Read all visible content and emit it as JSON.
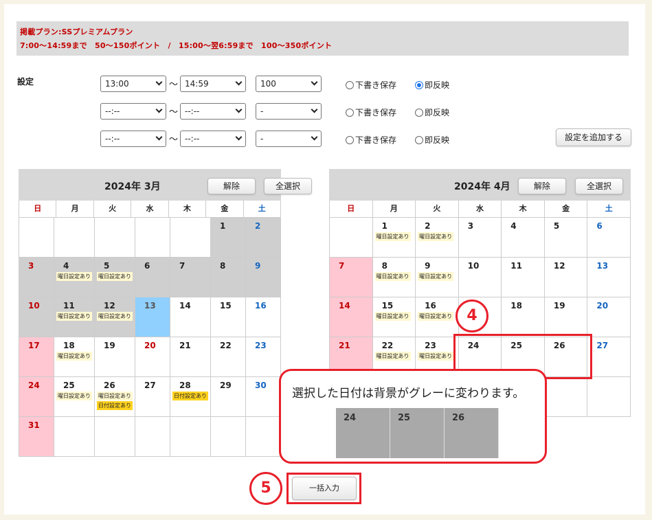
{
  "plan": {
    "line1": "掲載プラン:SSプレミアムプラン",
    "line2": "7:00〜14:59まで　50〜150ポイント　/　15:00〜翌6:59まで　100〜350ポイント"
  },
  "settings": {
    "label": "設定",
    "tilde": "〜",
    "rows": [
      {
        "start": "13:00",
        "end": "14:59",
        "points": "100",
        "draft": "下書き保存",
        "instant": "即反映",
        "mode": "instant"
      },
      {
        "start": "--:--",
        "end": "--:--",
        "points": "-",
        "draft": "下書き保存",
        "instant": "即反映",
        "mode": ""
      },
      {
        "start": "--:--",
        "end": "--:--",
        "points": "-",
        "draft": "下書き保存",
        "instant": "即反映",
        "mode": ""
      }
    ],
    "add_label": "設定を追加する"
  },
  "weekdays": [
    "日",
    "月",
    "火",
    "水",
    "木",
    "金",
    "土"
  ],
  "calendars": [
    {
      "title": "2024年 3月",
      "clear": "解除",
      "select_all": "全選択",
      "cells": [
        {
          "d": "",
          "bg": ""
        },
        {
          "d": "",
          "bg": ""
        },
        {
          "d": "",
          "bg": ""
        },
        {
          "d": "",
          "bg": ""
        },
        {
          "d": "",
          "bg": ""
        },
        {
          "d": "1",
          "bg": "grey"
        },
        {
          "d": "2",
          "bg": "grey"
        },
        {
          "d": "3",
          "bg": "grey"
        },
        {
          "d": "4",
          "bg": "grey",
          "tags": [
            "曜日設定あり"
          ]
        },
        {
          "d": "5",
          "bg": "grey",
          "tags": [
            "曜日設定あり"
          ]
        },
        {
          "d": "6",
          "bg": "grey"
        },
        {
          "d": "7",
          "bg": "grey"
        },
        {
          "d": "8",
          "bg": "grey"
        },
        {
          "d": "9",
          "bg": "grey"
        },
        {
          "d": "10",
          "bg": "grey"
        },
        {
          "d": "11",
          "bg": "grey",
          "tags": [
            "曜日設定あり"
          ]
        },
        {
          "d": "12",
          "bg": "grey",
          "tags": [
            "曜日設定あり"
          ]
        },
        {
          "d": "13",
          "bg": "sky"
        },
        {
          "d": "14",
          "bg": ""
        },
        {
          "d": "15",
          "bg": ""
        },
        {
          "d": "16",
          "bg": ""
        },
        {
          "d": "17",
          "bg": "pink"
        },
        {
          "d": "18",
          "bg": "",
          "tags": [
            "曜日設定あり"
          ]
        },
        {
          "d": "19",
          "bg": ""
        },
        {
          "d": "20",
          "bg": ""
        },
        {
          "d": "21",
          "bg": ""
        },
        {
          "d": "22",
          "bg": ""
        },
        {
          "d": "23",
          "bg": ""
        },
        {
          "d": "24",
          "bg": "pink"
        },
        {
          "d": "25",
          "bg": "",
          "tags": [
            "曜日設定あり"
          ]
        },
        {
          "d": "26",
          "bg": "",
          "tags": [
            "曜日設定あり",
            "日付設定あり"
          ]
        },
        {
          "d": "27",
          "bg": ""
        },
        {
          "d": "28",
          "bg": "",
          "tags": [
            "日付設定あり"
          ]
        },
        {
          "d": "29",
          "bg": ""
        },
        {
          "d": "30",
          "bg": ""
        },
        {
          "d": "31",
          "bg": "pink"
        },
        {
          "d": "",
          "bg": ""
        },
        {
          "d": "",
          "bg": ""
        },
        {
          "d": "",
          "bg": ""
        },
        {
          "d": "",
          "bg": ""
        },
        {
          "d": "",
          "bg": ""
        },
        {
          "d": "",
          "bg": ""
        }
      ]
    },
    {
      "title": "2024年 4月",
      "clear": "解除",
      "select_all": "全選択",
      "cells": [
        {
          "d": "",
          "bg": ""
        },
        {
          "d": "1",
          "bg": "",
          "tags": [
            "曜日設定あり"
          ]
        },
        {
          "d": "2",
          "bg": "",
          "tags": [
            "曜日設定あり"
          ]
        },
        {
          "d": "3",
          "bg": ""
        },
        {
          "d": "4",
          "bg": ""
        },
        {
          "d": "5",
          "bg": ""
        },
        {
          "d": "6",
          "bg": ""
        },
        {
          "d": "7",
          "bg": "pink"
        },
        {
          "d": "8",
          "bg": "",
          "tags": [
            "曜日設定あり"
          ]
        },
        {
          "d": "9",
          "bg": "",
          "tags": [
            "曜日設定あり"
          ]
        },
        {
          "d": "10",
          "bg": ""
        },
        {
          "d": "11",
          "bg": ""
        },
        {
          "d": "12",
          "bg": ""
        },
        {
          "d": "13",
          "bg": ""
        },
        {
          "d": "14",
          "bg": "pink"
        },
        {
          "d": "15",
          "bg": "",
          "tags": [
            "曜日設定あり"
          ]
        },
        {
          "d": "16",
          "bg": "",
          "tags": [
            "曜日設定あり"
          ]
        },
        {
          "d": "17",
          "bg": ""
        },
        {
          "d": "18",
          "bg": ""
        },
        {
          "d": "19",
          "bg": ""
        },
        {
          "d": "20",
          "bg": ""
        },
        {
          "d": "21",
          "bg": "pink"
        },
        {
          "d": "22",
          "bg": "",
          "tags": [
            "曜日設定あり"
          ]
        },
        {
          "d": "23",
          "bg": "",
          "tags": [
            "曜日設定あり"
          ]
        },
        {
          "d": "24",
          "bg": ""
        },
        {
          "d": "25",
          "bg": ""
        },
        {
          "d": "26",
          "bg": ""
        },
        {
          "d": "27",
          "bg": ""
        },
        {
          "d": "",
          "bg": ""
        },
        {
          "d": "",
          "bg": ""
        },
        {
          "d": "",
          "bg": ""
        },
        {
          "d": "",
          "bg": ""
        },
        {
          "d": "",
          "bg": ""
        },
        {
          "d": "",
          "bg": ""
        },
        {
          "d": "",
          "bg": ""
        }
      ]
    }
  ],
  "callout": {
    "text": "選択した日付は背景がグレーに変わります。",
    "sample": [
      "24",
      "25",
      "26"
    ]
  },
  "markers": {
    "four": "4",
    "five": "5"
  },
  "bulk_label": "一括入力",
  "colors": {
    "accent_red": "#e8202a",
    "plan_red": "#c40000",
    "saturday_blue": "#1565c0"
  }
}
